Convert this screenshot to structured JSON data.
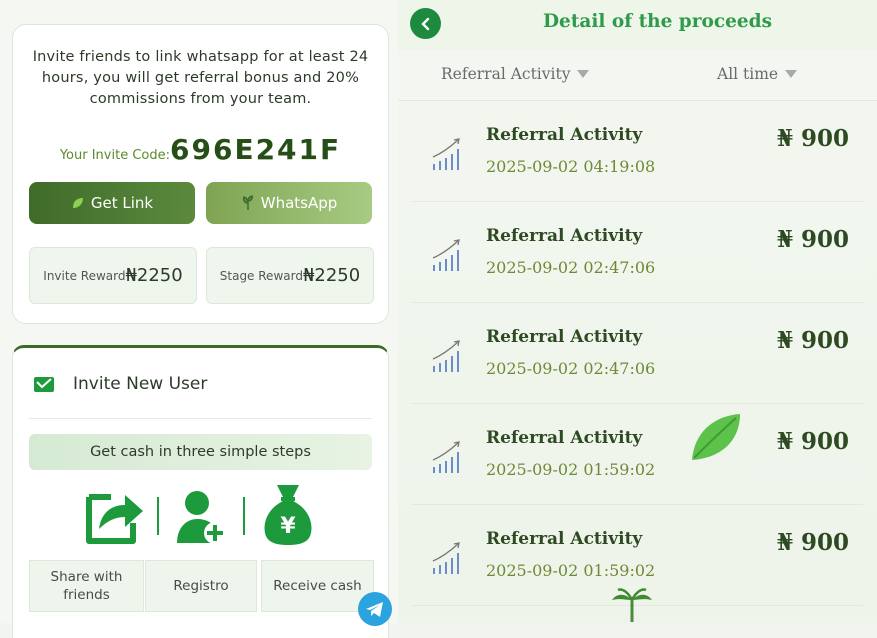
{
  "invite_card": {
    "intro_text": "Invite friends to link whatsapp for at least 24 hours, you will get referral bonus and 20% commissions from your team.",
    "code_label": "Your Invite Code:",
    "code_value": "696E241F",
    "get_link_label": "Get Link",
    "whatsapp_label": "WhatsApp",
    "invite_reward_label": "Invite Reward",
    "invite_reward_value": "₦2250",
    "stage_reward_label": "Stage Reward",
    "stage_reward_value": "₦2250"
  },
  "invite_new_user": {
    "title": "Invite New User",
    "steps_bar": "Get cash in three simple steps",
    "steps": [
      {
        "label": "Share with friends",
        "icon": "share-icon"
      },
      {
        "label": "Registro",
        "icon": "add-user-icon"
      },
      {
        "label": "Receive cash",
        "icon": "money-bag-icon"
      }
    ]
  },
  "detail": {
    "title": "Detail of the proceeds",
    "filter_type": "Referral Activity",
    "filter_time": "All time",
    "records": [
      {
        "title": "Referral Activity",
        "time": "2025-09-02 04:19:08",
        "amount": "₦ 900"
      },
      {
        "title": "Referral Activity",
        "time": "2025-09-02 02:47:06",
        "amount": "₦ 900"
      },
      {
        "title": "Referral Activity",
        "time": "2025-09-02 02:47:06",
        "amount": "₦ 900"
      },
      {
        "title": "Referral Activity",
        "time": "2025-09-02 01:59:02",
        "amount": "₦ 900"
      },
      {
        "title": "Referral Activity",
        "time": "2025-09-02 01:59:02",
        "amount": "₦ 900"
      }
    ]
  },
  "colors": {
    "primary_green": "#3f6b29",
    "accent_green": "#2e9a4a",
    "icon_green": "#1d9a3c"
  }
}
